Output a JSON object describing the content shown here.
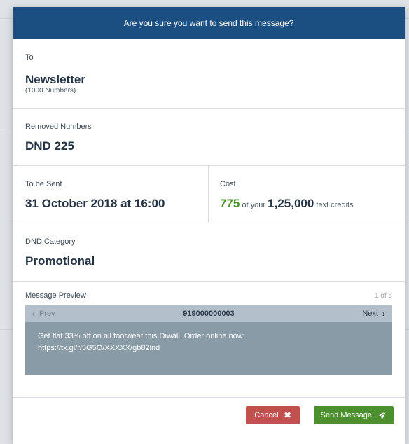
{
  "modal": {
    "title": "Are you sure you want to send this message?"
  },
  "recipient": {
    "label": "To",
    "name": "Newsletter",
    "count": "(1000 Numbers)"
  },
  "removed": {
    "label": "Removed Numbers",
    "value": "DND 225"
  },
  "schedule": {
    "label": "To be Sent",
    "value": "31 October 2018 at 16:00"
  },
  "cost": {
    "label": "Cost",
    "amount": "775",
    "of_your": "of your",
    "total": "1,25,000",
    "suffix": "text credits"
  },
  "dnd": {
    "label": "DND Category",
    "value": "Promotional"
  },
  "preview": {
    "label": "Message Preview",
    "page": "1 of 5",
    "prev_label": "Prev",
    "number": "919000000003",
    "next_label": "Next",
    "message_line1": "Get flat 33% off on all footwear this Diwali. Order online now:",
    "message_line2": "https://tx.gl/r/5G5O/XXXXX/gb82lnd"
  },
  "actions": {
    "cancel_label": "Cancel",
    "send_label": "Send Message"
  },
  "colors": {
    "header": "#1b4f82",
    "cancel": "#c0514f",
    "send": "#4c8f2e",
    "cost_highlight": "#4a8f2a"
  },
  "icons": {
    "prev": "chevron-left-icon",
    "next": "chevron-right-icon",
    "cancel": "close-icon",
    "send": "paper-plane-icon"
  }
}
